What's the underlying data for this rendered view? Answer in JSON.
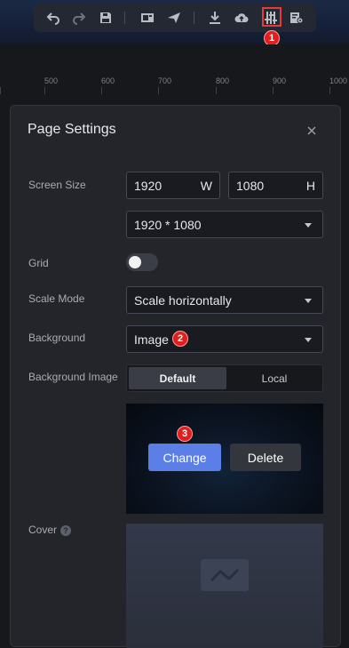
{
  "toolbar": {
    "icons": [
      "undo-icon",
      "redo-icon",
      "save-icon",
      "preview-icon",
      "publish-icon",
      "download-icon",
      "upload-cloud-icon",
      "page-settings-icon",
      "config-icon"
    ]
  },
  "ruler": {
    "ticks": [
      "500",
      "600",
      "700",
      "800",
      "900",
      "1000"
    ]
  },
  "badges": {
    "b1": "1",
    "b2": "2",
    "b3": "3"
  },
  "settings": {
    "title": "Page Settings",
    "screen_size": {
      "label": "Screen Size",
      "width": "1920",
      "width_suffix": "W",
      "height": "1080",
      "height_suffix": "H",
      "preset": "1920 * 1080"
    },
    "grid": {
      "label": "Grid",
      "enabled": false
    },
    "scale_mode": {
      "label": "Scale Mode",
      "value": "Scale horizontally"
    },
    "background": {
      "label": "Background",
      "value": "Image"
    },
    "background_image": {
      "label": "Background Image",
      "tab_default": "Default",
      "tab_local": "Local",
      "change": "Change",
      "delete": "Delete"
    },
    "cover": {
      "label": "Cover",
      "help": "?"
    }
  },
  "colors": {
    "accent": "#5b7fe6",
    "badge": "#e01f1f",
    "panel": "#23252b"
  }
}
